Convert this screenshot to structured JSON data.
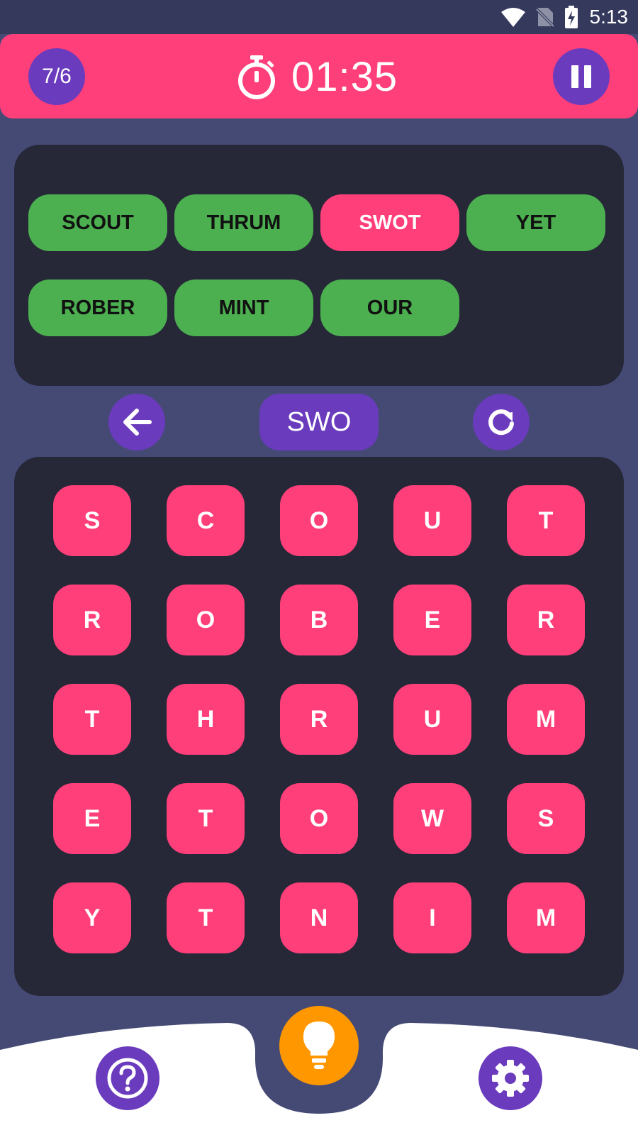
{
  "status_bar": {
    "time": "5:13",
    "icons": [
      "wifi-icon",
      "no-sim-icon",
      "battery-charging-icon"
    ]
  },
  "header": {
    "level": "7/6",
    "timer": "01:35",
    "icons": [
      "stopwatch-icon",
      "pause-icon"
    ]
  },
  "words": [
    {
      "text": "SCOUT",
      "state": "found"
    },
    {
      "text": "THRUM",
      "state": "found"
    },
    {
      "text": "SWOT",
      "state": "active"
    },
    {
      "text": "YET",
      "state": "found"
    },
    {
      "text": "ROBER",
      "state": "found"
    },
    {
      "text": "MINT",
      "state": "found"
    },
    {
      "text": "OUR",
      "state": "found"
    }
  ],
  "controls": {
    "current_word": "SWO",
    "icons": [
      "back-arrow-icon",
      "refresh-icon"
    ]
  },
  "grid": [
    [
      "S",
      "C",
      "O",
      "U",
      "T"
    ],
    [
      "R",
      "O",
      "B",
      "E",
      "R"
    ],
    [
      "T",
      "H",
      "R",
      "U",
      "M"
    ],
    [
      "E",
      "T",
      "O",
      "W",
      "S"
    ],
    [
      "Y",
      "T",
      "N",
      "I",
      "M"
    ]
  ],
  "bottom_bar": {
    "icons": [
      "help-icon",
      "lightbulb-icon",
      "gear-icon"
    ]
  },
  "colors": {
    "background": "#454a75",
    "accent_pink": "#ff3f7a",
    "purple": "#6a3bbd",
    "green": "#4caf50",
    "orange": "#ff9800",
    "panel": "#262838"
  }
}
